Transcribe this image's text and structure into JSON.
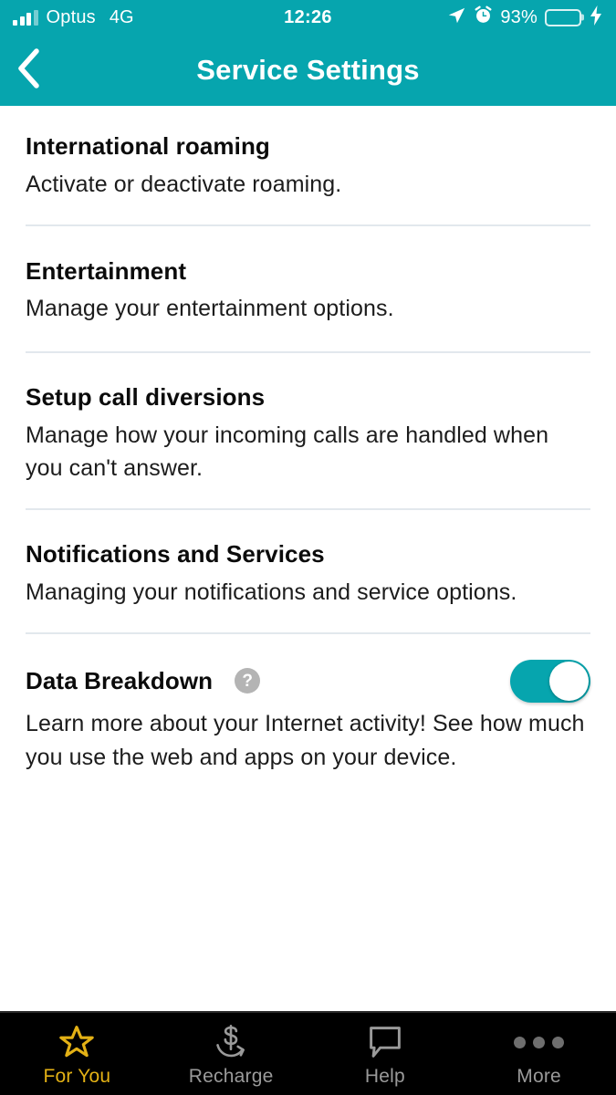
{
  "status_bar": {
    "carrier": "Optus",
    "network": "4G",
    "time": "12:26",
    "battery_percent": "93%",
    "battery_level": 93,
    "battery_charging": true,
    "icons": [
      "signal-bars-icon",
      "location-arrow-icon",
      "alarm-clock-icon",
      "battery-icon",
      "lightning-bolt-icon"
    ]
  },
  "header": {
    "title": "Service Settings",
    "back_icon": "chevron-left-icon",
    "background_color": "#06A5AE"
  },
  "settings": {
    "items": [
      {
        "title": "International roaming",
        "description": "Activate or deactivate roaming.",
        "has_toggle": false,
        "has_help": false
      },
      {
        "title": "Entertainment",
        "description": "Manage your entertainment options.",
        "has_toggle": false,
        "has_help": false
      },
      {
        "title": "Setup call diversions",
        "description": "Manage how your incoming calls are handled when you can't answer.",
        "has_toggle": false,
        "has_help": false
      },
      {
        "title": "Notifications and Services",
        "description": "Managing your notifications and service options.",
        "has_toggle": false,
        "has_help": false
      },
      {
        "title": "Data Breakdown",
        "description": "Learn more about your Internet activity! See how much you use the web and apps on your device.",
        "has_toggle": true,
        "toggle_state": "on",
        "has_help": true,
        "help_glyph": "?"
      }
    ]
  },
  "tab_bar": {
    "background_color": "#000000",
    "active_color": "#E3B115",
    "inactive_color": "#9a9a9a",
    "tabs": [
      {
        "label": "For You",
        "icon": "star-icon",
        "active": true
      },
      {
        "label": "Recharge",
        "icon": "dollar-refresh-icon",
        "active": false
      },
      {
        "label": "Help",
        "icon": "speech-bubble-icon",
        "active": false
      },
      {
        "label": "More",
        "icon": "ellipsis-icon",
        "active": false
      }
    ]
  }
}
